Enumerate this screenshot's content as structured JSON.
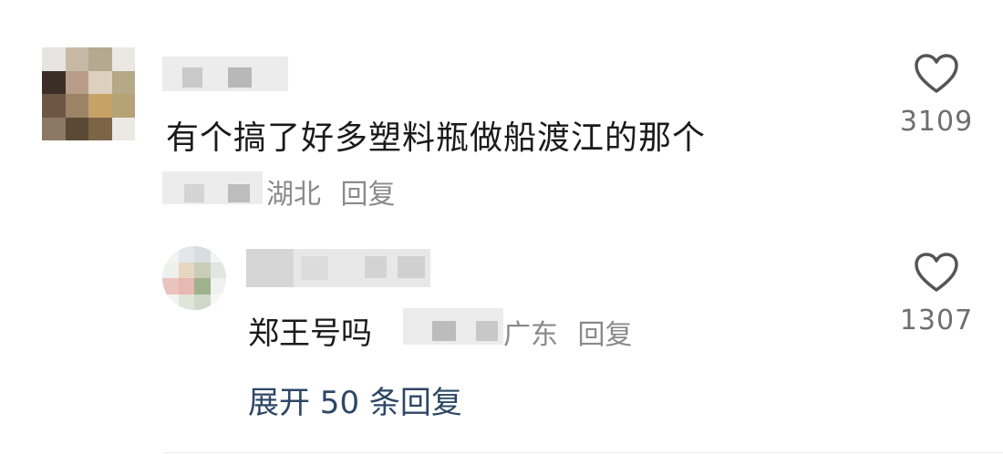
{
  "comment": {
    "text": "有个搞了好多塑料瓶做船渡江的那个",
    "location": "湖北",
    "reply_label": "回复",
    "like_count": "3109",
    "like_icon": "heart-outline-icon"
  },
  "reply": {
    "text": "郑王号吗",
    "location": "广东",
    "reply_label": "回复",
    "like_count": "1307",
    "like_icon": "heart-outline-icon"
  },
  "expand_label": "展开 50 条回复",
  "colors": {
    "link": "#2e4766",
    "meta": "#8a8a8a",
    "icon": "#555555"
  }
}
